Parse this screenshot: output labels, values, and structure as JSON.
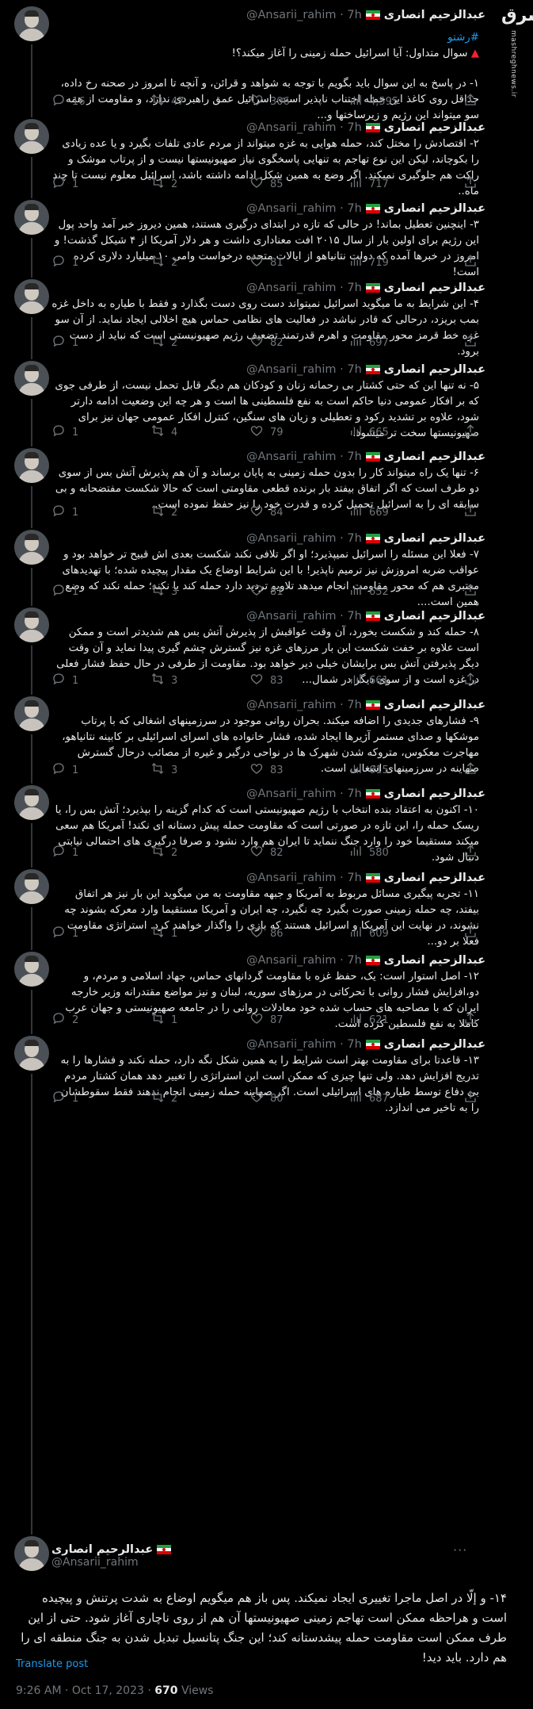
{
  "site_logo": {
    "mark": "مشرق",
    "url": "mashreghnews.ir"
  },
  "author": {
    "name": "عبدالرحیم انصاری",
    "handle": "@Ansarii_rahim",
    "age": "7h",
    "flag": "iran-flag"
  },
  "tweets": [
    {
      "hashtag": "#رشتو",
      "question": "سوال متداول: آیا اسرائیل حمله زمینی را آغاز میکند؟!",
      "text": "۱- در پاسخ به این سوال باید بگویم با توجه به شواهد و قرائن، و آنچه تا امروز در صحنه رخ داده، حداقل روی کاغذ این حمله اجتناب ناپذیر است. اسرائیل عمق راهبردی ندارد، و مقاومت از همه سو میتواند این رژیم و زیرساختها و...",
      "replies": "16",
      "retweets": "47",
      "likes": "306",
      "views": "4,595"
    },
    {
      "text": "۲- اقتصادش را مختل کند، حمله هوایی به غزه میتواند از مردم عادی تلفات بگیرد و یا عده زیادی را بکوچاند، لیکن این نوع تهاجم به تنهایی پاسخگوی نیاز صهیونیستها نیست و از پرتاب موشک و راکت هم جلوگیری نمیکند. اگر وضع به همین شکل ادامه داشته باشد، اسرائیل معلوم نیست تا چند ماه..",
      "replies": "1",
      "retweets": "2",
      "likes": "85",
      "views": "717"
    },
    {
      "text": "۳- اینچنین تعطیل بماند! در حالی که تازه در ابتدای درگیری هستند، همین دیروز خبر آمد واحد پول این رژیم برای اولین بار از سال ۲۰۱۵ افت معناداری داشت و هر دلار آمریکا از ۴ شیکل گذشت! و امروز در خبرها آمده که دولت نتانیاهو از ایالات متحده درخواست وامی ۱۰ میلیارد دلاری کرده است!",
      "replies": "1",
      "retweets": "2",
      "likes": "81",
      "views": "719"
    },
    {
      "text": "۴- این شرایط به ما میگوید اسرائیل نمیتواند دست روی دست بگذارد و فقط با طیاره به داخل غزه بمب بریزد، درحالی که قادر نباشد در فعالیت های نظامی حماس هیچ اخلالی ایجاد نماید. از آن سو غزه خط قرمز محور مقاومت و اهرم قدرتمند تضعیف رژیم صهیونیستی است که نباید از دست برود.",
      "replies": "1",
      "retweets": "2",
      "likes": "82",
      "views": "697"
    },
    {
      "text": "۵- نه تنها این که حتی کشتار بی رحمانه زنان و کودکان هم دیگر قابل تحمل نیست، از طرفی جوی که بر افکار عمومی دنیا حاکم است به نفع فلسطینی ها است و هر چه این وضعیت ادامه دارتر شود، علاوه بر تشدید رکود و تعطیلی و زیان های سنگین، کنترل افکار عمومی جهان نیز برای صهیونیستها سخت تر میشود.",
      "replies": "1",
      "retweets": "4",
      "likes": "79",
      "views": "665"
    },
    {
      "text": "۶- تنها یک راه میتواند کار را بدون حمله زمینی به پایان برساند و آن هم پذیرش آتش بس از سوی دو طرف است که اگر اتفاق بیفتد بار برنده قطعی مقاومتی است که حالا شکست مفتضحانه و بی سابقه ای را به اسرائیل تحمیل کرده و قدرت خود را نیز حفظ نموده است.",
      "replies": "1",
      "retweets": "2",
      "likes": "84",
      "views": "669"
    },
    {
      "text": "۷- فعلا این مسئله را اسرائیل نمیپذیرد؛ او اگر تلافی نکند شکست بعدی اش قبیح تر خواهد بود و عواقب ضربه امروزش نیز ترمیم ناپذیر! با این شرایط اوضاع یک مقدار پیچیده شده؛ با تهدیدهای معتبری هم که محور مقاومت انجام میدهد تلاویو تردید دارد حمله کند یا نکند؛ حمله نکند که وضع همین است....",
      "replies": "1",
      "retweets": "3",
      "likes": "81",
      "views": "652"
    },
    {
      "text": "۸- حمله کند و شکست بخورد، آن وقت عواقبش از پذیرش آتش بس هم شدیدتر است و ممکن است علاوه بر خفت شکست این بار مرزهای غزه نیز گسترش چشم گیری پیدا نماید و آن وقت دیگر پذیرفتن آتش بس برایشان خیلی دیر خواهد بود. مقاومت از طرفی در حال حفظ فشار فعلی در غزه است و از سوی دیگر در شمال...",
      "replies": "1",
      "retweets": "3",
      "likes": "83",
      "views": "661"
    },
    {
      "text": "۹- فشارهای جدیدی را اضافه میکند. بحران روانی موجود در سرزمینهای اشغالی که با پرتاب موشکها و صدای مستمر آژیرها ایجاد شده، فشار خانواده های اسرای اسرائیلی بر کابینه نتانیاهو، مهاجرت معکوس، متروکه شدن شهرک ها در نواحی درگیر و غیره از مصائب درحال گسترش صهاینه در سرزمینهای اشغالی است.",
      "replies": "1",
      "retweets": "3",
      "likes": "83",
      "views": "615"
    },
    {
      "text": "۱۰- اکنون به اعتقاد بنده انتخاب با رژیم صهیونیستی است که کدام گزینه را بپذیرد؛ آتش بس را، یا ریسک حمله را، این تازه در صورتی است که مقاومت حمله پیش دستانه ای نکند! آمریکا هم سعی میکند مستقیما خود را وارد جنگ ننماید تا ایران هم وارد نشود و صرفا درگیری های احتمالی نیابتی دنبال شود.",
      "replies": "1",
      "retweets": "2",
      "likes": "82",
      "views": "580"
    },
    {
      "text": "۱۱- تجربه پیگیری مسائل مربوط به آمریکا و جبهه مقاومت به من میگوید این بار نیز هر اتفاق بیفتد، چه حمله زمینی صورت بگیرد چه نگیرد، چه ایران و آمریکا مستقیما وارد معرکه بشوند چه نشوند، در نهایت این آمریکا و اسرائیل هستند که بازی را واگذار خواهند کرد. استراتژی مقاومت فعلا بر دو...",
      "replies": "1",
      "retweets": "1",
      "likes": "86",
      "views": "609"
    },
    {
      "text": "۱۲- اصل استوار است: یک، حفظ غزه با مقاومت گردانهای حماس، جهاد اسلامی و مردم، و دو،افزایش فشار روانی با تحرکاتی در مرزهای سوریه، لبنان و نیز مواضع مقتدرانه وزیر خارجه ایران که با مصاحبه های حساب شده خود معادلات روانی را در جامعه صهیونیستی و جهان عرب کاملا به نفع فلسطین کرده است.",
      "replies": "2",
      "retweets": "1",
      "likes": "87",
      "views": "621"
    },
    {
      "text": "۱۳- قاعدتا برای مقاومت بهتر است شرایط را به همین شکل نگه دارد، حمله نکند و فشارها را به تدریج افزایش دهد. ولی تنها چیزی که ممکن است این استراتژی را تغییر دهد همان کشتار مردم بی دفاع توسط طیاره های اسرائیلی است. اگر صهاینه حمله زمینی انجام ندهند فقط سقوطشان را به تاخیر می اندازد.",
      "replies": "1",
      "retweets": "2",
      "likes": "80",
      "views": "687"
    }
  ],
  "final_tweet": {
    "name": "عبدالرحیم انصاری",
    "handle": "@Ansarii_rahim",
    "text": "۱۴- و إلّا در اصل ماجرا تغییری ایجاد نمیکند. پس باز هم میگویم اوضاع به شدت پرتنش و پیچیده است و هراحظه ممکن است تهاجم زمینی صهیونیستها آن هم از روی ناچاری آغاز شود. حتی از این طرف ممکن است مقاومت حمله پیشدستانه کند؛ این جنگ پتانسیل تبدیل شدن به جنگ منطقه ای را هم دارد. باید دید!",
    "translate_label": "Translate post",
    "time": "9:26 AM",
    "date": "Oct 17, 2023",
    "views_count": "670",
    "views_label": "Views"
  }
}
